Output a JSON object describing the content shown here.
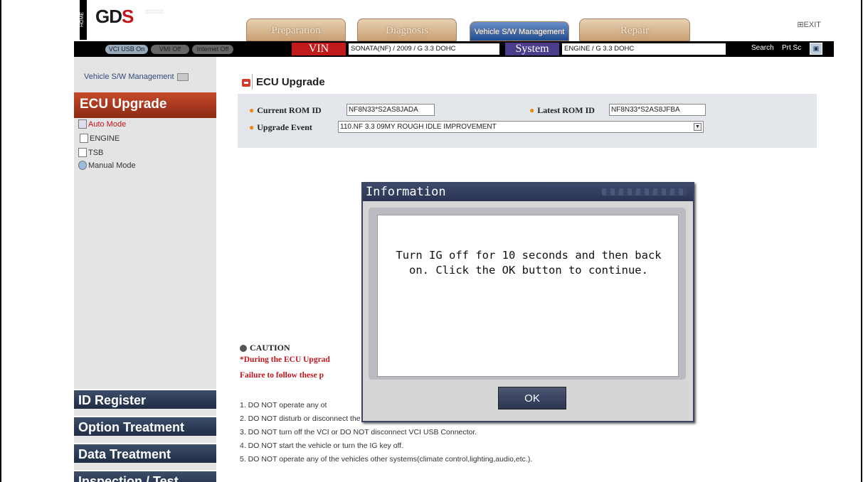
{
  "header": {
    "home_label": "HOME",
    "logo_text": "GD",
    "exit_label": "EXIT",
    "tabs": [
      {
        "label": "Preparation"
      },
      {
        "label": "Diagnosis"
      },
      {
        "label": "Vehicle S/W Management"
      },
      {
        "label": "Repair"
      }
    ]
  },
  "statusbar": {
    "vci_usb": "VCI USB On",
    "vmi": "VMI Off",
    "internet": "Internet Off",
    "vin_label": "VIN",
    "vin_value": "SONATA(NF) / 2009 / G 3.3 DOHC",
    "system_label": "System",
    "system_value": "ENGINE / G 3.3 DOHC",
    "search_label": "Search",
    "prtsc_label": "Prt Sc"
  },
  "sidebar": {
    "vsw_link": "Vehicle S/W Management",
    "ecu_upgrade": "ECU Upgrade",
    "tree": [
      {
        "label": "Auto Mode"
      },
      {
        "label": "ENGINE"
      },
      {
        "label": "TSB"
      },
      {
        "label": "Manual Mode"
      }
    ],
    "nav": [
      {
        "label": "ID Register"
      },
      {
        "label": "Option Treatment"
      },
      {
        "label": "Data Treatment"
      },
      {
        "label": "Inspection / Test"
      }
    ]
  },
  "main": {
    "title": "ECU Upgrade",
    "current_rom_label": "Current ROM ID",
    "current_rom_value": "NF8N33*S2AS8JADA",
    "latest_rom_label": "Latest ROM ID",
    "latest_rom_value": "NF8N33*S2AS8JFBA",
    "upgrade_event_label": "Upgrade Event",
    "upgrade_event_value": "110.NF 3.3 09MY ROUGH IDLE IMPROVEMENT",
    "caution_head": "CAUTION",
    "caution_line1": "*During the ECU Upgrad",
    "caution_line2": "Failure to follow these p",
    "rules": [
      "1. DO NOT operate any ot",
      "2. DO NOT disturb or disconnect the DLC(Data Link Connector).",
      "3. DO NOT turn off the VCI or DO NOT disconnect VCI USB Connector.",
      "4. DO NOT start the vehicle or turn the IG key off.",
      "5. DO NOT operate any of the vehicles other systems(climate control,lighting,audio,etc.)."
    ]
  },
  "dialog": {
    "title": "Information",
    "message": "Turn IG off for 10 seconds and then back on. Click the OK button to continue.",
    "ok_label": "OK"
  }
}
